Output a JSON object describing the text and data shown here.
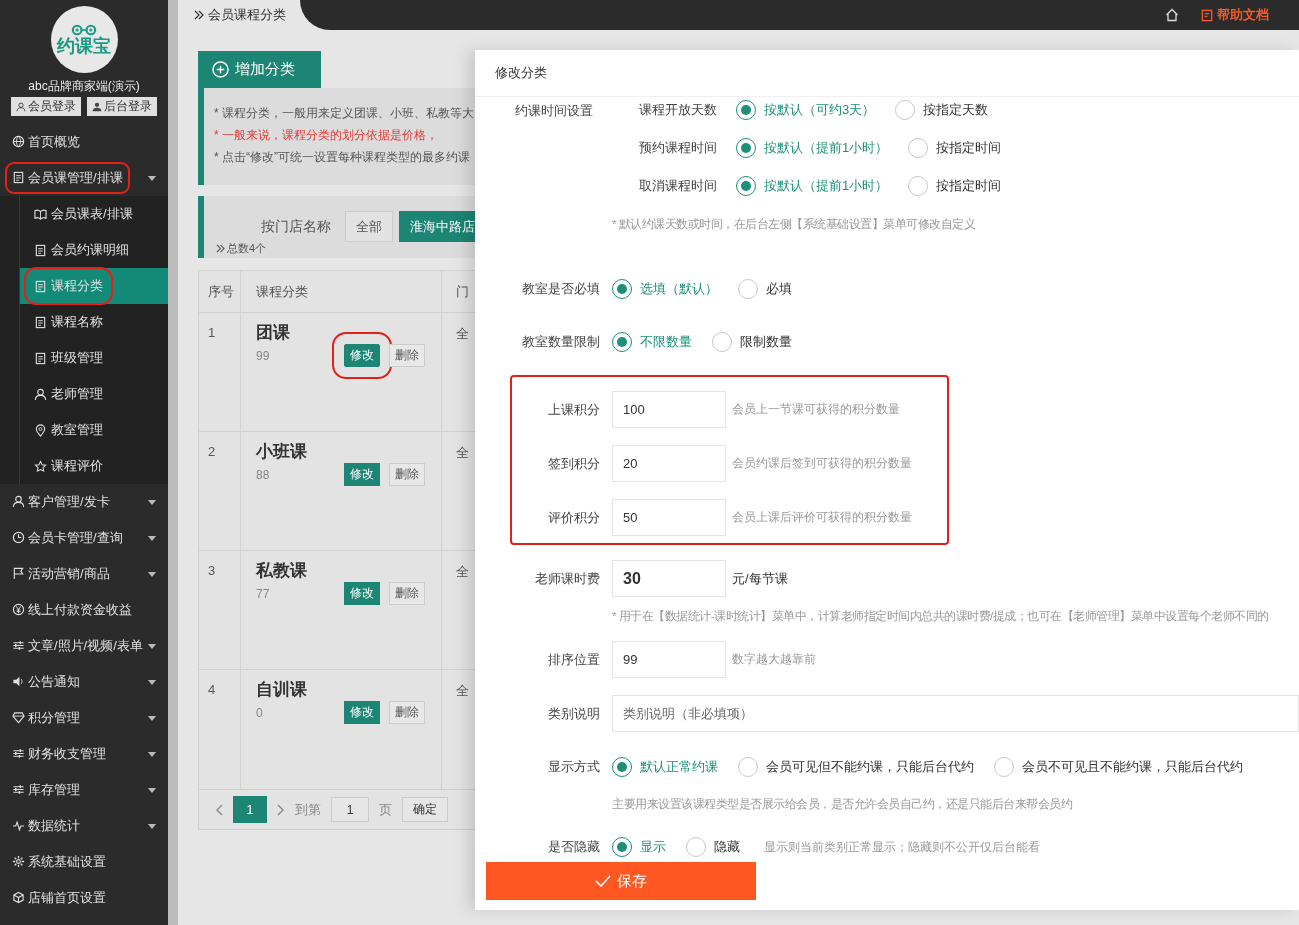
{
  "sidebar": {
    "logo_text": "约课宝",
    "account": "abc品牌商家端(演示)",
    "login_buttons": [
      {
        "label": "会员登录"
      },
      {
        "label": "后台登录"
      }
    ],
    "items": [
      {
        "label": "首页概览",
        "expandable": false,
        "highlighted": false
      },
      {
        "label": "会员课管理/排课",
        "expandable": true,
        "highlighted": true,
        "children": [
          {
            "label": "会员课表/排课",
            "selected": false,
            "highlighted": false
          },
          {
            "label": "会员约课明细",
            "selected": false,
            "highlighted": false
          },
          {
            "label": "课程分类",
            "selected": true,
            "highlighted": true
          },
          {
            "label": "课程名称",
            "selected": false,
            "highlighted": false
          },
          {
            "label": "班级管理",
            "selected": false,
            "highlighted": false
          },
          {
            "label": "老师管理",
            "selected": false,
            "highlighted": false
          },
          {
            "label": "教室管理",
            "selected": false,
            "highlighted": false
          },
          {
            "label": "课程评价",
            "selected": false,
            "highlighted": false
          }
        ]
      },
      {
        "label": "客户管理/发卡",
        "expandable": true,
        "highlighted": false
      },
      {
        "label": "会员卡管理/查询",
        "expandable": true,
        "highlighted": false
      },
      {
        "label": "活动营销/商品",
        "expandable": true,
        "highlighted": false
      },
      {
        "label": "线上付款资金收益",
        "expandable": false,
        "highlighted": false
      },
      {
        "label": "文章/照片/视频/表单",
        "expandable": true,
        "highlighted": false
      },
      {
        "label": "公告通知",
        "expandable": true,
        "highlighted": false
      },
      {
        "label": "积分管理",
        "expandable": true,
        "highlighted": false
      },
      {
        "label": "财务收支管理",
        "expandable": true,
        "highlighted": false
      },
      {
        "label": "库存管理",
        "expandable": true,
        "highlighted": false
      },
      {
        "label": "数据统计",
        "expandable": true,
        "highlighted": false
      },
      {
        "label": "系统基础设置",
        "expandable": false,
        "highlighted": false
      },
      {
        "label": "店铺首页设置",
        "expandable": false,
        "highlighted": false
      }
    ]
  },
  "topbar": {
    "breadcrumb": "会员课程分类",
    "help": "帮助文档"
  },
  "page": {
    "add_button": "增加分类",
    "notes": [
      {
        "text": "* 课程分类，一般用来定义团课、小班、私教等大",
        "kind": "normal"
      },
      {
        "text": "* 一般来说，课程分类的划分依据是价格，",
        "kind": "warning"
      },
      {
        "text": "* 点击“修改”可统一设置每种课程类型的最多约课",
        "kind": "normal"
      }
    ],
    "filter": {
      "label": "按门店名称",
      "options": [
        {
          "label": "全部",
          "selected": false
        },
        {
          "label": "淮海中路店",
          "selected": true
        }
      ]
    },
    "total": "总数4个"
  },
  "table": {
    "columns": [
      "序号",
      "课程分类",
      "门"
    ],
    "rows": [
      {
        "index": "1",
        "name": "团课",
        "sort": "99",
        "store": "全",
        "actions": [
          {
            "label": "修改",
            "kind": "primary",
            "highlighted": true
          },
          {
            "label": "删除",
            "kind": "default",
            "highlighted": false
          }
        ]
      },
      {
        "index": "2",
        "name": "小班课",
        "sort": "88",
        "store": "全",
        "actions": [
          {
            "label": "修改",
            "kind": "primary",
            "highlighted": false
          },
          {
            "label": "删除",
            "kind": "default",
            "highlighted": false
          }
        ]
      },
      {
        "index": "3",
        "name": "私教课",
        "sort": "77",
        "store": "全",
        "actions": [
          {
            "label": "修改",
            "kind": "primary",
            "highlighted": false
          },
          {
            "label": "删除",
            "kind": "default",
            "highlighted": false
          }
        ]
      },
      {
        "index": "4",
        "name": "自训课",
        "sort": "0",
        "store": "全",
        "actions": [
          {
            "label": "修改",
            "kind": "primary",
            "highlighted": false
          },
          {
            "label": "删除",
            "kind": "default",
            "highlighted": false
          }
        ]
      }
    ]
  },
  "pagination": {
    "pages": [
      {
        "label": "1",
        "selected": true
      }
    ],
    "goto_label": "到第",
    "page_input": "1",
    "page_unit": "页",
    "confirm": "确定"
  },
  "modal": {
    "title": "修改分类",
    "booking": {
      "label": "约课时间设置",
      "rows": [
        {
          "label": "课程开放天数",
          "options": [
            {
              "label": "按默认（可约3天）",
              "selected": true
            },
            {
              "label": "按指定天数",
              "selected": false
            }
          ]
        },
        {
          "label": "预约课程时间",
          "options": [
            {
              "label": "按默认（提前1小时）",
              "selected": true
            },
            {
              "label": "按指定时间",
              "selected": false
            }
          ]
        },
        {
          "label": "取消课程时间",
          "options": [
            {
              "label": "按默认（提前1小时）",
              "selected": true
            },
            {
              "label": "按指定时间",
              "selected": false
            }
          ]
        }
      ],
      "note": "* 默认约课天数或时间，在后台左侧【系统基础设置】菜单可修改自定义"
    },
    "fields": [
      {
        "kind": "radio",
        "label": "教室是否必填",
        "options": [
          {
            "label": "选填（默认）",
            "selected": true
          },
          {
            "label": "必填",
            "selected": false
          }
        ]
      },
      {
        "kind": "radio",
        "label": "教室数量限制",
        "options": [
          {
            "label": "不限数量",
            "selected": true
          },
          {
            "label": "限制数量",
            "selected": false
          }
        ]
      },
      {
        "kind": "group",
        "highlighted": true,
        "fields": [
          {
            "kind": "input",
            "label": "上课积分",
            "value": "100",
            "hint": "会员上一节课可获得的积分数量"
          },
          {
            "kind": "input",
            "label": "签到积分",
            "value": "20",
            "hint": "会员约课后签到可获得的积分数量"
          },
          {
            "kind": "input",
            "label": "评价积分",
            "value": "50",
            "hint": "会员上课后评价可获得的积分数量"
          }
        ]
      },
      {
        "kind": "input",
        "label": "老师课时费",
        "value": "30",
        "strong": true,
        "suffix": "元/每节课",
        "note": "* 用于在【数据统计-课时统计】菜单中，计算老师指定时间内总共的课时费/提成；也可在【老师管理】菜单中设置每个老师不同的"
      },
      {
        "kind": "input",
        "label": "排序位置",
        "value": "99",
        "hint": "数字越大越靠前"
      },
      {
        "kind": "text",
        "label": "类别说明",
        "placeholder": "类别说明（非必填项）"
      },
      {
        "kind": "radio",
        "label": "显示方式",
        "options": [
          {
            "label": "默认正常约课",
            "selected": true
          },
          {
            "label": "会员可见但不能约课，只能后台代约",
            "selected": false
          },
          {
            "label": "会员不可见且不能约课，只能后台代约",
            "selected": false
          }
        ],
        "note": "主要用来设置该课程类型是否展示给会员，是否允许会员自己约，还是只能后台来帮会员约"
      },
      {
        "kind": "radio",
        "label": "是否隐藏",
        "options": [
          {
            "label": "显示",
            "selected": true
          },
          {
            "label": "隐藏",
            "selected": false
          }
        ],
        "hint": "显示则当前类别正常显示；隐藏则不公开仅后台能看"
      }
    ],
    "save": "保存"
  }
}
